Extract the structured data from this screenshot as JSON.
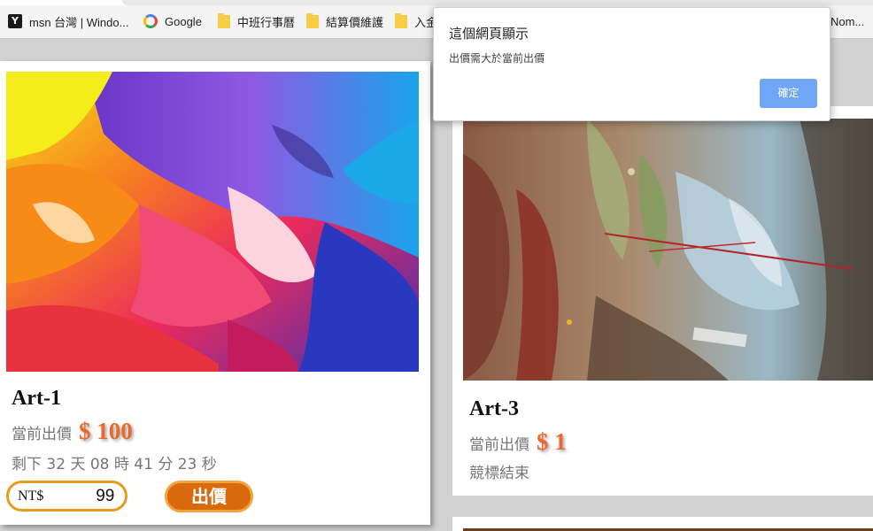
{
  "bookmarks": [
    {
      "label": "msn 台灣 | Windo...",
      "icon": "msn-icon"
    },
    {
      "label": "Google",
      "icon": "google-icon"
    },
    {
      "label": "中班行事曆",
      "icon": "folder-icon"
    },
    {
      "label": "結算價維護",
      "icon": "folder-icon"
    },
    {
      "label": "入金",
      "icon": "folder-icon"
    },
    {
      "label": "Nom...",
      "icon": "folder-icon"
    }
  ],
  "cards": [
    {
      "title": "Art-1",
      "bid_label": "當前出價",
      "bid_amount": "$ 100",
      "time_text": "剩下 32 天 08 時 41 分 23 秒",
      "currency_label": "NT$",
      "bid_input_value": "99",
      "bid_button_label": "出價"
    },
    {
      "title": "Art-3",
      "bid_label": "當前出價",
      "bid_amount": "$ 1",
      "time_text": "競標結束"
    }
  ],
  "dialog": {
    "title": "這個網頁顯示",
    "message": "出價需大於當前出價",
    "ok_label": "確定",
    "ok_color": "#6fa6f6"
  },
  "colors": {
    "accent_orange": "#e8692a",
    "button_orange": "#d9690d",
    "input_border": "#e89a1e"
  }
}
